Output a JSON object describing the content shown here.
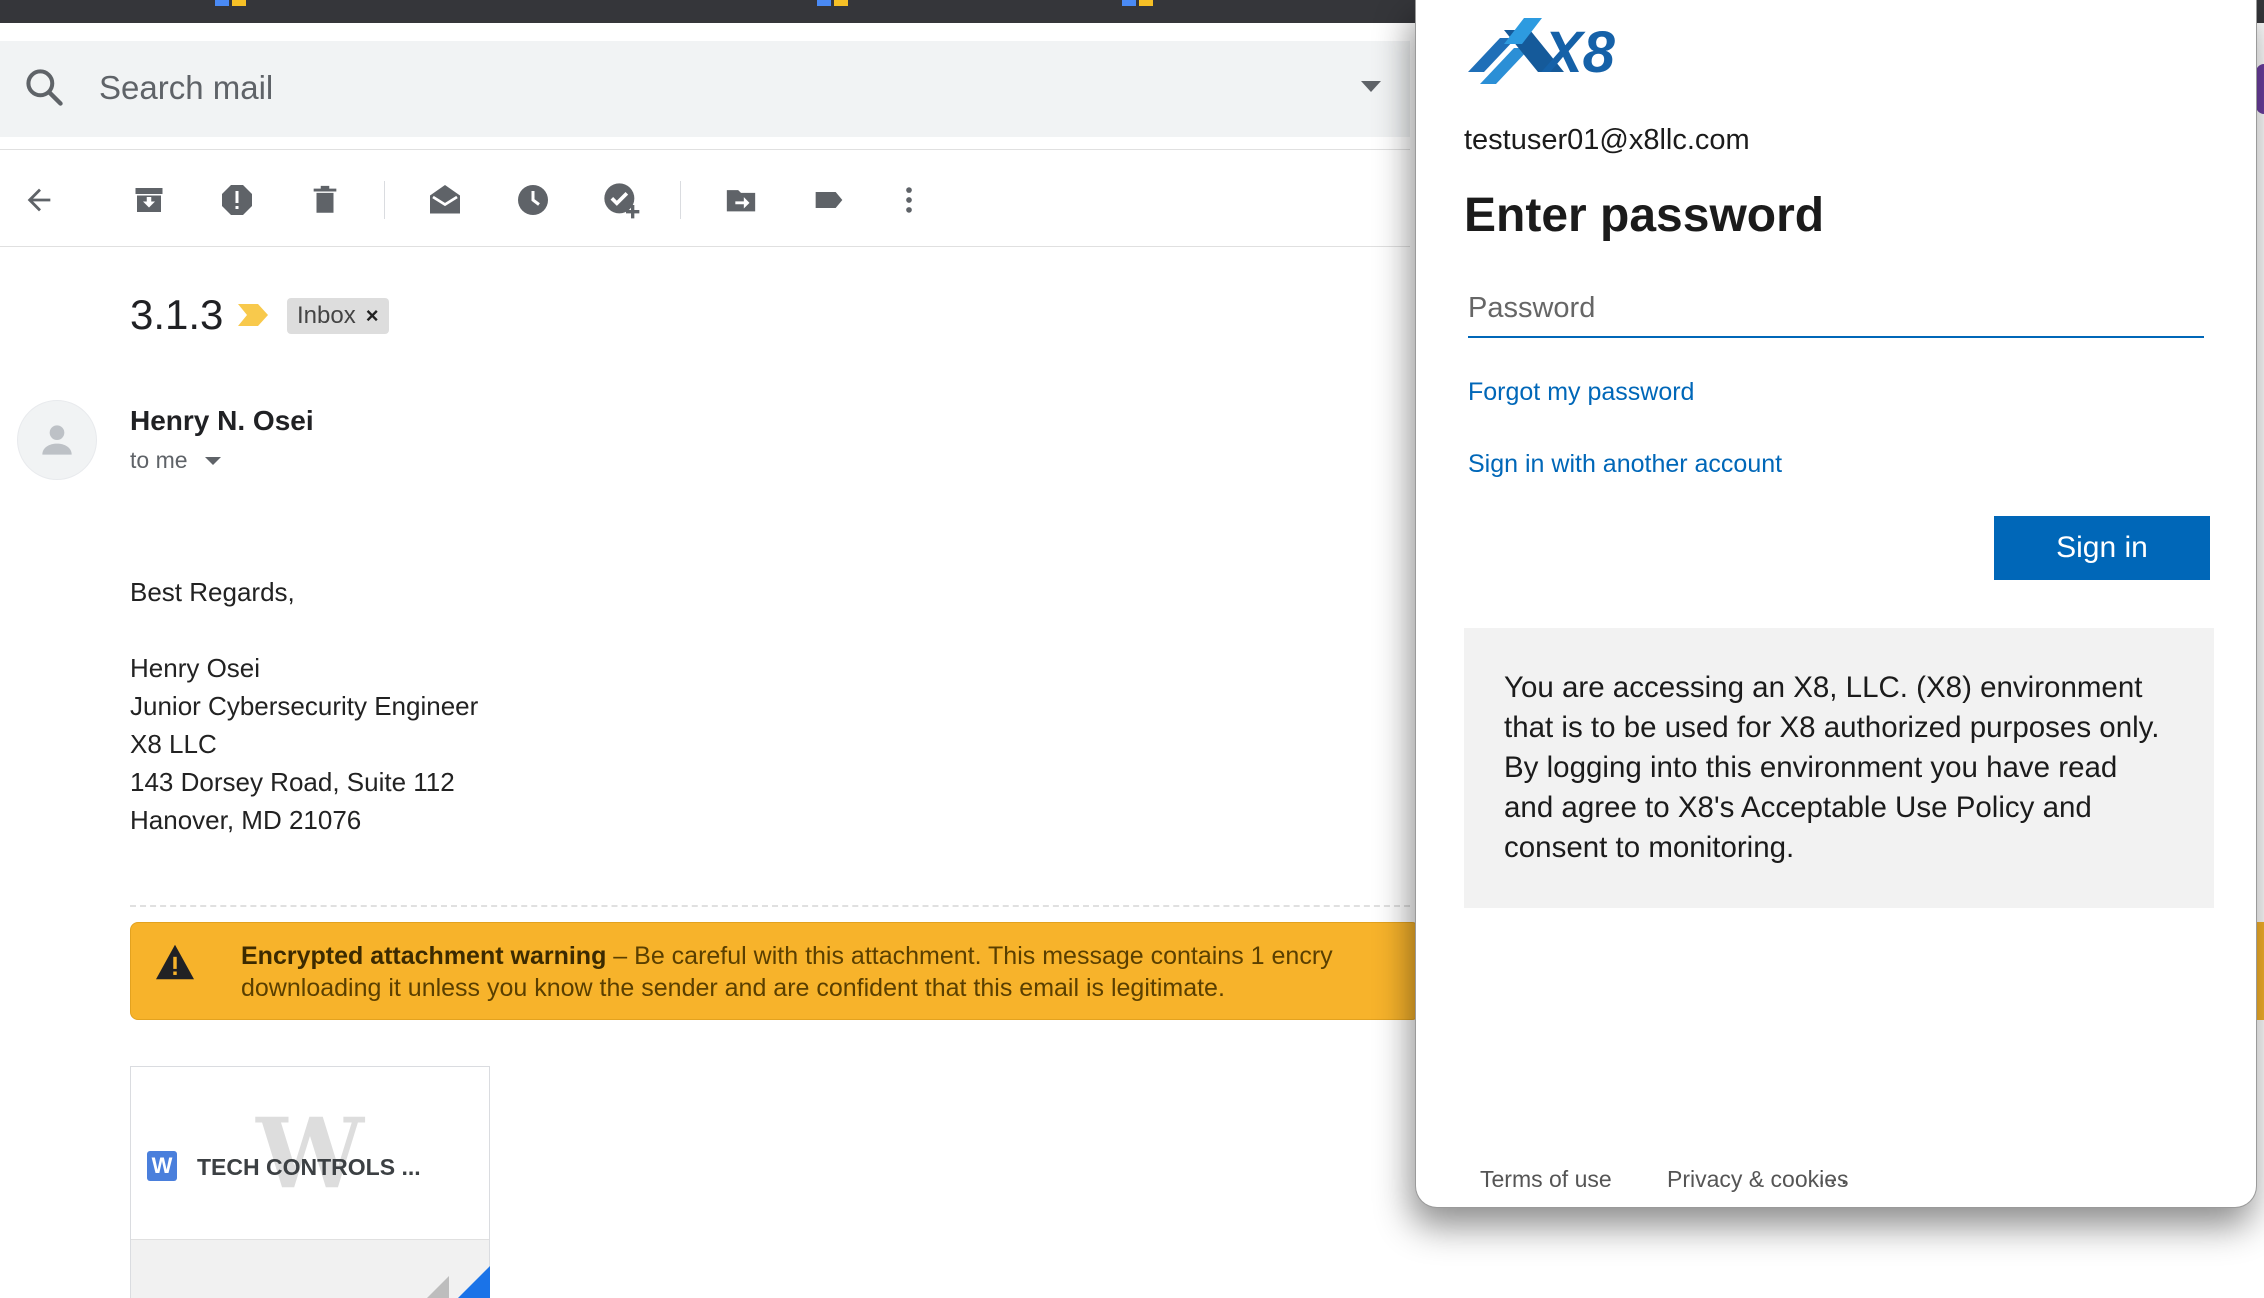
{
  "search": {
    "placeholder": "Search mail"
  },
  "toolbar": {
    "buttons": [
      "back-icon",
      "archive-icon",
      "report-spam-icon",
      "delete-icon",
      "mark-unread-icon",
      "snooze-icon",
      "add-to-tasks-icon",
      "move-to-icon",
      "label-icon",
      "more-icon"
    ]
  },
  "email": {
    "subject": "3.1.3",
    "label_chip": "Inbox",
    "label_remove": "×",
    "sender": "Henry N. Osei",
    "recipient": "to me",
    "body": {
      "greeting": "Best Regards,",
      "signature": [
        "Henry Osei",
        "Junior Cybersecurity Engineer",
        "X8 LLC",
        "143 Dorsey Road, Suite 112",
        "Hanover, MD 21076"
      ]
    },
    "warning": {
      "title": "Encrypted attachment warning",
      "line1": " – Be careful with this attachment. This message contains 1 encry",
      "line2": "downloading it unless you know the sender and are confident that this email is legitimate."
    },
    "attachment": {
      "preview_letter": "W",
      "type_badge": "W",
      "name": "TECH CONTROLS ..."
    }
  },
  "login": {
    "brand": "X8",
    "account": "testuser01@x8llc.com",
    "heading": "Enter password",
    "password_placeholder": "Password",
    "forgot_link": "Forgot my password",
    "other_account_link": "Sign in with another account",
    "signin_button": "Sign in",
    "notice": "You are accessing an X8, LLC. (X8) environment that is to be used for X8 authorized purposes only. By logging into this environment you have read and agree to X8's Acceptable Use Policy and consent to monitoring.",
    "footer": {
      "terms": "Terms of use",
      "privacy": "Privacy & cookies",
      "more": "..."
    }
  },
  "colors": {
    "accent": "#0067b8",
    "warning": "#f7b32b",
    "chrome": "#35363a"
  }
}
